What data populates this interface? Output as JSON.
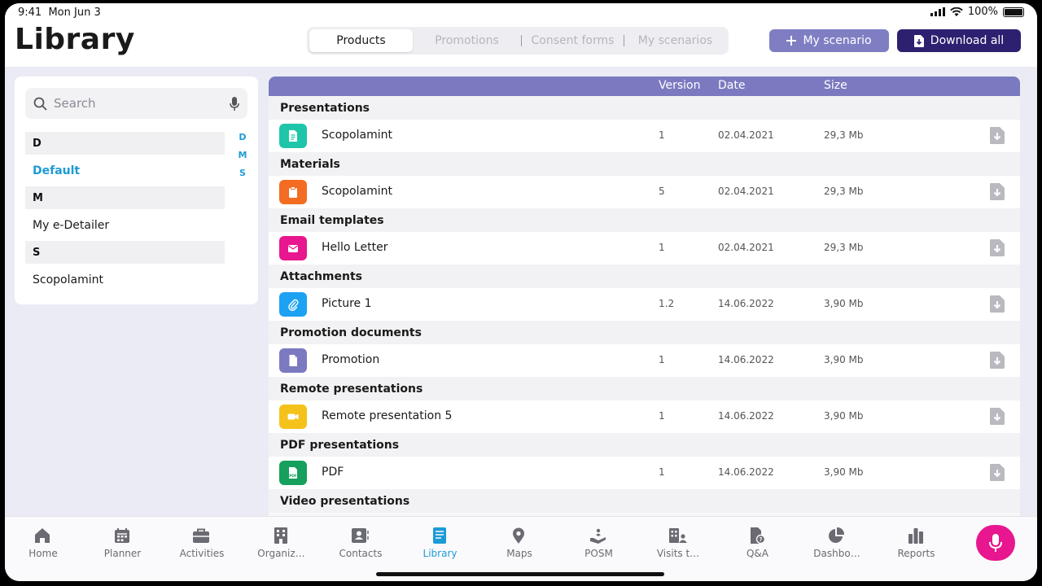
{
  "status": {
    "time": "9:41",
    "date": "Mon Jun 3",
    "battery": "100%"
  },
  "header": {
    "title": "Library",
    "tabs": [
      {
        "label": "Products",
        "active": true
      },
      {
        "label": "Promotions",
        "active": false
      },
      {
        "label": "Consent forms",
        "active": false
      },
      {
        "label": "My scenarios",
        "active": false
      }
    ],
    "scenario_button": "My scenario",
    "download_button": "Download all"
  },
  "sidebar": {
    "search_placeholder": "Search",
    "groups": [
      {
        "letter": "D",
        "items": [
          {
            "label": "Default",
            "selected": true
          }
        ]
      },
      {
        "letter": "M",
        "items": [
          {
            "label": "My e-Detailer",
            "selected": false
          }
        ]
      },
      {
        "letter": "S",
        "items": [
          {
            "label": "Scopolamint",
            "selected": false
          }
        ]
      }
    ],
    "index": [
      "D",
      "M",
      "S"
    ]
  },
  "table": {
    "columns": {
      "version": "Version",
      "date": "Date",
      "size": "Size"
    },
    "groups": [
      {
        "title": "Presentations",
        "rows": [
          {
            "name": "Scopolamint",
            "version": "1",
            "date": "02.04.2021",
            "size": "29,3 Mb",
            "icon": "presentation-icon",
            "color": "#1fc5a8"
          }
        ]
      },
      {
        "title": "Materials",
        "rows": [
          {
            "name": "Scopolamint",
            "version": "5",
            "date": "02.04.2021",
            "size": "29,3 Mb",
            "icon": "clipboard-icon",
            "color": "#f36c21"
          }
        ]
      },
      {
        "title": "Email templates",
        "rows": [
          {
            "name": "Hello Letter",
            "version": "1",
            "date": "02.04.2021",
            "size": "29,3 Mb",
            "icon": "mail-icon",
            "color": "#e8168f"
          }
        ]
      },
      {
        "title": "Attachments",
        "rows": [
          {
            "name": "Picture 1",
            "version": "1.2",
            "date": "14.06.2022",
            "size": "3,90 Mb",
            "icon": "paperclip-icon",
            "color": "#1da1f2"
          }
        ]
      },
      {
        "title": "Promotion documents",
        "rows": [
          {
            "name": "Promotion",
            "version": "1",
            "date": "14.06.2022",
            "size": "3,90 Mb",
            "icon": "document-icon",
            "color": "#7b7ac0"
          }
        ]
      },
      {
        "title": "Remote presentations",
        "rows": [
          {
            "name": "Remote presentation 5",
            "version": "1",
            "date": "14.06.2022",
            "size": "3,90 Mb",
            "icon": "video-camera-icon",
            "color": "#f5c21b"
          }
        ]
      },
      {
        "title": "PDF presentations",
        "rows": [
          {
            "name": "PDF",
            "version": "1",
            "date": "14.06.2022",
            "size": "3,90 Mb",
            "icon": "pdf-icon",
            "color": "#16a05d"
          }
        ]
      },
      {
        "title": "Video presentations",
        "rows": []
      }
    ]
  },
  "bottom_nav": [
    {
      "label": "Home",
      "icon": "home-icon",
      "active": false
    },
    {
      "label": "Planner",
      "icon": "calendar-icon",
      "active": false
    },
    {
      "label": "Activities",
      "icon": "briefcase-icon",
      "active": false
    },
    {
      "label": "Organiz…",
      "icon": "building-icon",
      "active": false
    },
    {
      "label": "Contacts",
      "icon": "contact-card-icon",
      "active": false
    },
    {
      "label": "Library",
      "icon": "book-icon",
      "active": true
    },
    {
      "label": "Maps",
      "icon": "map-pin-icon",
      "active": false
    },
    {
      "label": "POSM",
      "icon": "hand-icon",
      "active": false
    },
    {
      "label": "Visits t…",
      "icon": "visits-icon",
      "active": false
    },
    {
      "label": "Q&A",
      "icon": "qa-icon",
      "active": false
    },
    {
      "label": "Dashbo…",
      "icon": "pie-chart-icon",
      "active": false
    },
    {
      "label": "Reports",
      "icon": "bar-chart-icon",
      "active": false
    }
  ],
  "colors": {
    "accent": "#1d9ad6",
    "header_bar": "#7b7ac0",
    "primary_dark": "#2d2070",
    "mic": "#e8168f"
  }
}
